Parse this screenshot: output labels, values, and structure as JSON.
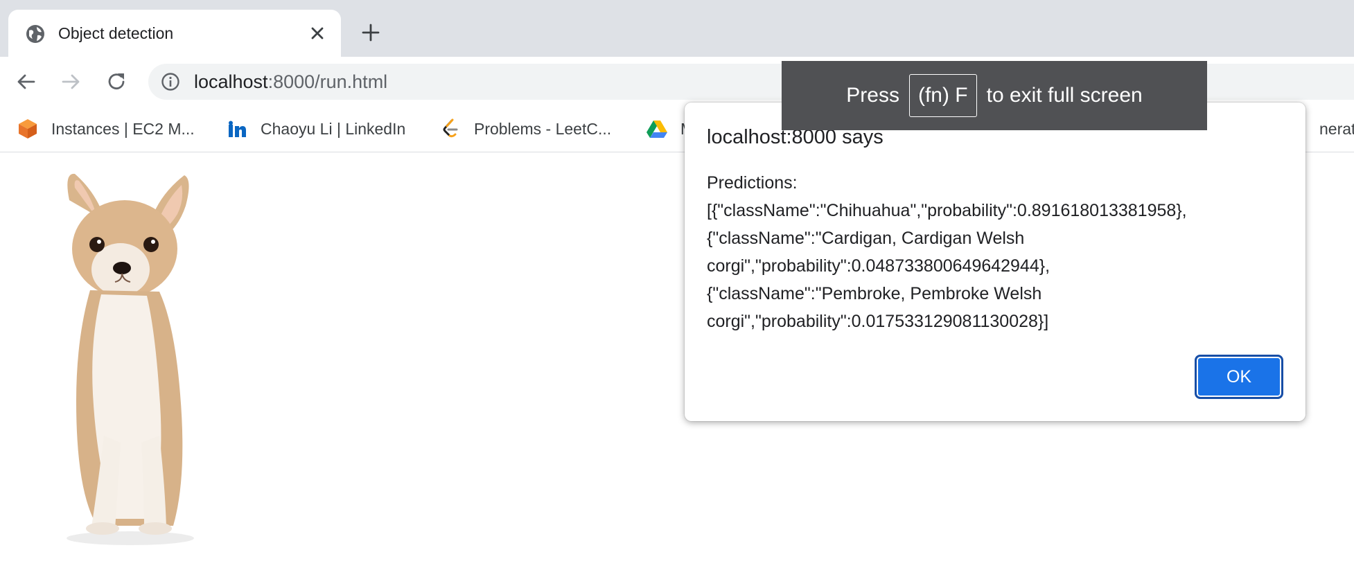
{
  "tab": {
    "title": "Object detection"
  },
  "address_bar": {
    "host": "localhost",
    "rest": ":8000/run.html"
  },
  "bookmarks": [
    {
      "label": "Instances | EC2 M...",
      "icon": "aws-cube-icon"
    },
    {
      "label": "Chaoyu Li | LinkedIn",
      "icon": "linkedin-icon"
    },
    {
      "label": "Problems - LeetC...",
      "icon": "leetcode-icon"
    },
    {
      "label": "M",
      "icon": "google-drive-icon"
    },
    {
      "label": "nerato",
      "icon": ""
    }
  ],
  "fullscreen_toast": {
    "press": "Press",
    "key": "(fn) F",
    "suffix": "to exit full screen"
  },
  "dialog": {
    "title": "localhost:8000 says",
    "lines": [
      "Predictions:",
      "[{\"className\":\"Chihuahua\",\"probability\":0.891618013381958},",
      "{\"className\":\"Cardigan, Cardigan Welsh",
      "corgi\",\"probability\":0.048733800649642944},",
      "{\"className\":\"Pembroke, Pembroke Welsh",
      "corgi\",\"probability\":0.017533129081130028}]"
    ],
    "ok_label": "OK"
  },
  "colors": {
    "accent": "#1a73e8",
    "tabstrip": "#dee1e6",
    "toast": "#505154"
  }
}
